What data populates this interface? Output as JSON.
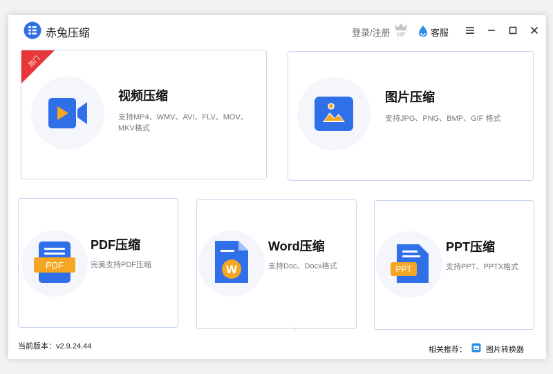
{
  "app": {
    "title": "赤兔压缩"
  },
  "header": {
    "login_label": "登录/注册",
    "vip_text": "VIP",
    "service_label": "客服"
  },
  "cards": {
    "video": {
      "title": "视频压缩",
      "desc": "支持MP4、WMV、AVI、FLV、MOV、MKV格式",
      "badge": "热门",
      "icon": "video-camera-icon"
    },
    "image": {
      "title": "图片压缩",
      "desc": "支持JPG、PNG、BMP、GIF 格式",
      "icon": "image-icon"
    },
    "pdf": {
      "title": "PDF压缩",
      "desc": "完美支持PDF压缩",
      "icon_text": "PDF",
      "icon": "pdf-file-icon"
    },
    "word": {
      "title": "Word压缩",
      "desc": "支持Doc、Docx格式",
      "icon_text": "W",
      "icon": "word-file-icon"
    },
    "ppt": {
      "title": "PPT压缩",
      "desc": "支持PPT、PPTX格式",
      "icon_text": "PPT",
      "icon": "ppt-file-icon"
    }
  },
  "footer": {
    "version": "当前版本：v2.9.24.44",
    "recommend_label": "相关推荐：",
    "recommend_link": "图片转换器"
  },
  "colors": {
    "accent_blue": "#2f6fe8",
    "hot_red": "#e8373a",
    "orange": "#f5a623",
    "card_border": "#c8d6ec"
  }
}
